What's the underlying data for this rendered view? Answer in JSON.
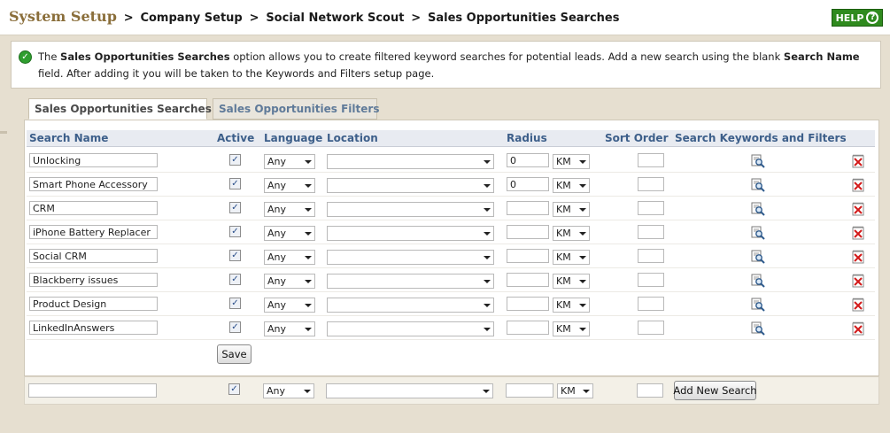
{
  "breadcrumb": {
    "root": "System Setup",
    "sep": ">",
    "items": [
      "Company Setup",
      "Social Network Scout",
      "Sales Opportunities Searches"
    ]
  },
  "help": {
    "label": "HELP",
    "glyph": "?"
  },
  "info": {
    "pre": "The ",
    "bold1": "Sales Opportunities Searches",
    "mid": " option allows you to create filtered keyword searches for potential leads. Add a new search using the blank ",
    "bold2": "Search Name",
    "post": " field. After adding it you will be taken to the Keywords and Filters setup page."
  },
  "tabs": [
    {
      "label": "Sales Opportunities Searches",
      "active": true
    },
    {
      "label": "Sales Opportunities Filters",
      "active": false
    }
  ],
  "columns": {
    "name": "Search Name",
    "active": "Active",
    "language": "Language",
    "location": "Location",
    "radius": "Radius",
    "sort": "Sort Order",
    "keywords": "Search Keywords and Filters"
  },
  "rows": [
    {
      "name": "Unlocking",
      "active": true,
      "language": "Any",
      "location": "",
      "radius": "0",
      "unit": "KM",
      "sort": ""
    },
    {
      "name": "Smart Phone Accessory",
      "active": true,
      "language": "Any",
      "location": "",
      "radius": "0",
      "unit": "KM",
      "sort": ""
    },
    {
      "name": "CRM",
      "active": true,
      "language": "Any",
      "location": "",
      "radius": "",
      "unit": "KM",
      "sort": ""
    },
    {
      "name": "iPhone Battery Replacer",
      "active": true,
      "language": "Any",
      "location": "",
      "radius": "",
      "unit": "KM",
      "sort": ""
    },
    {
      "name": "Social CRM",
      "active": true,
      "language": "Any",
      "location": "",
      "radius": "",
      "unit": "KM",
      "sort": ""
    },
    {
      "name": "Blackberry issues",
      "active": true,
      "language": "Any",
      "location": "",
      "radius": "",
      "unit": "KM",
      "sort": ""
    },
    {
      "name": "Product Design",
      "active": true,
      "language": "Any",
      "location": "",
      "radius": "",
      "unit": "KM",
      "sort": ""
    },
    {
      "name": "LinkedInAnswers",
      "active": true,
      "language": "Any",
      "location": "",
      "radius": "",
      "unit": "KM",
      "sort": ""
    }
  ],
  "save_label": "Save",
  "new_search": {
    "name": "",
    "active": true,
    "language": "Any",
    "location": "",
    "radius": "",
    "unit": "KM",
    "sort": "",
    "button_label": "Add New Search"
  },
  "icons": {
    "search": "magnifier-page-icon",
    "delete": "red-x-delete-icon",
    "info": "green-check-icon"
  },
  "colors": {
    "header_text": "#8a6e3a",
    "column_header": "#3d5f8a",
    "help_bg": "#2f8a1e",
    "tab_inactive_text": "#5f7a99"
  }
}
